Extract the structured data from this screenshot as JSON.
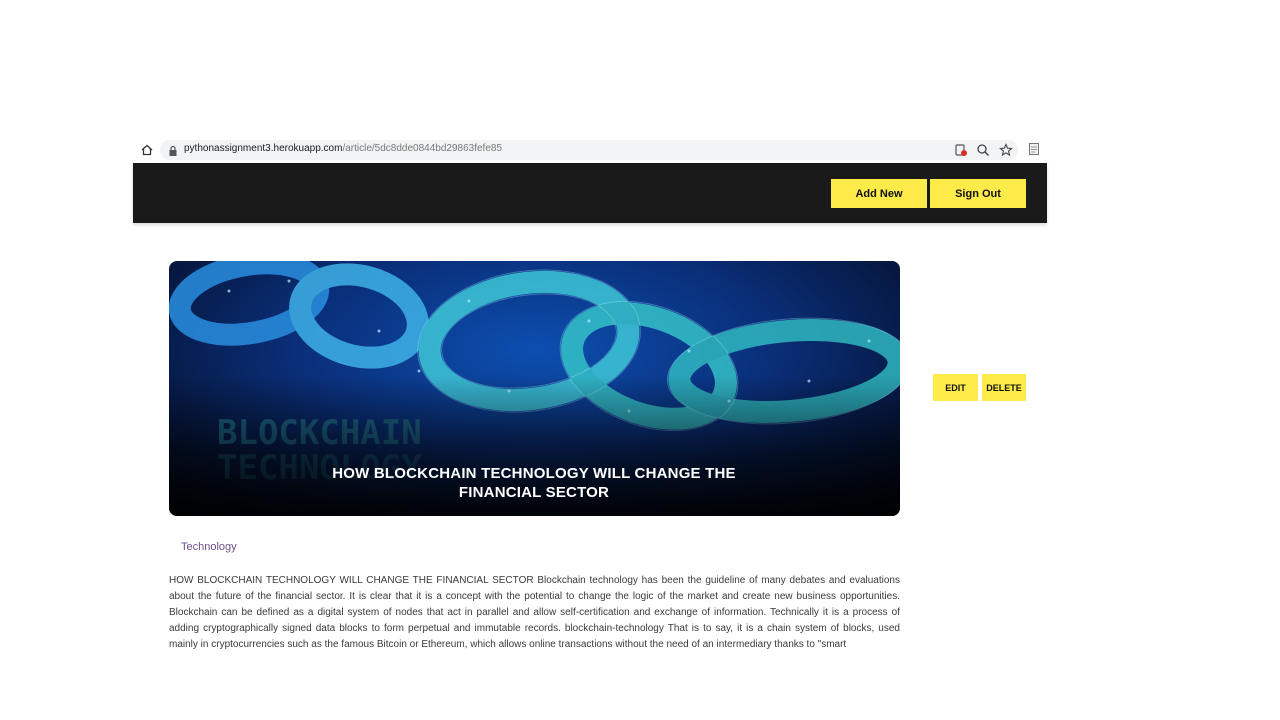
{
  "browser": {
    "url_host": "pythonassignment3.herokuapp.com",
    "url_path": "/article/5dc8dde0844bd29863fefe85",
    "icons": [
      "home-icon",
      "lock-icon",
      "blocked-icon",
      "zoom-icon",
      "star-icon",
      "page-icon"
    ]
  },
  "header": {
    "add_new_label": "Add New",
    "sign_out_label": "Sign Out"
  },
  "article": {
    "image_text": "BLOCKCHAIN TECHNOLOGY",
    "title": "HOW BLOCKCHAIN TECHNOLOGY WILL CHANGE THE FINANCIAL SECTOR",
    "edit_label": "EDIT",
    "delete_label": "DELETE",
    "category": "Technology",
    "body": "HOW BLOCKCHAIN TECHNOLOGY WILL CHANGE THE FINANCIAL SECTOR Blockchain technology has been the guideline of many debates and evaluations about the future of the financial sector. It is clear that it is a concept with the potential to change the logic of the market and create new business opportunities. Blockchain can be defined as a digital system of nodes that act in parallel and allow self-certification and exchange of information. Technically it is a process of adding cryptographically signed data blocks to form perpetual and immutable records. blockchain-technology That is to say, it is a chain system of blocks, used mainly in cryptocurrencies such as the famous Bitcoin or Ethereum, which allows online transactions without the need of an intermediary thanks to \"smart"
  },
  "colors": {
    "header_bg": "#1a1a1a",
    "button_yellow": "#fdeb4a",
    "category_text": "#6b4f8a"
  }
}
